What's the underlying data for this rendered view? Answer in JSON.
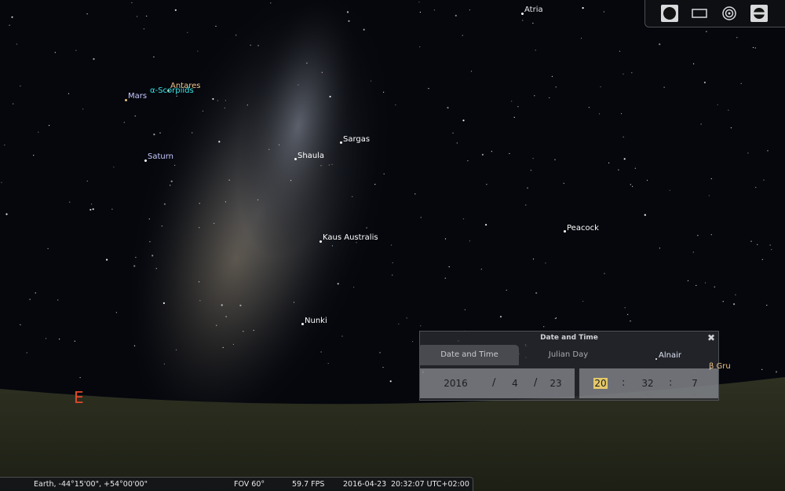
{
  "sky": {
    "stars": [
      {
        "name": "Atria",
        "color": "#e6e8ee"
      },
      {
        "name": "Antares",
        "color": "#f0c58a"
      },
      {
        "name": "α-Scorpiids",
        "color": "#39e6e6"
      },
      {
        "name": "Mars",
        "color": "#c9c8ff"
      },
      {
        "name": "Saturn",
        "color": "#c9c8ff"
      },
      {
        "name": "Sargas",
        "color": "#dfe3f0"
      },
      {
        "name": "Shaula",
        "color": "#dfe3f0"
      },
      {
        "name": "Kaus Australis",
        "color": "#dfe3f0"
      },
      {
        "name": "Peacock",
        "color": "#dfe3f0"
      },
      {
        "name": "Nunki",
        "color": "#dfe3f0"
      },
      {
        "name": "Alnair",
        "color": "#dfe3f0"
      },
      {
        "name": "β Gru",
        "color": "#f0c58a"
      }
    ],
    "cardinal": "E"
  },
  "toolbar": {
    "buttons": [
      "circle-icon",
      "rectangle-icon",
      "target-icon",
      "ocular-icon"
    ]
  },
  "dialog": {
    "title": "Date and Time",
    "close": "✖",
    "tabs": [
      "Date and Time",
      "Julian Day"
    ],
    "date": {
      "year": "2016",
      "month": "4",
      "day": "23",
      "sep": "/"
    },
    "time": {
      "hour": "20",
      "minute": "32",
      "second": "7",
      "sep": ":"
    }
  },
  "status": {
    "location": "Earth, -44°15'00\", +54°00'00\"",
    "fov": "FOV 60°",
    "fps": "59.7 FPS",
    "date": "2016-04-23",
    "time": "20:32:07 UTC+02:00"
  }
}
